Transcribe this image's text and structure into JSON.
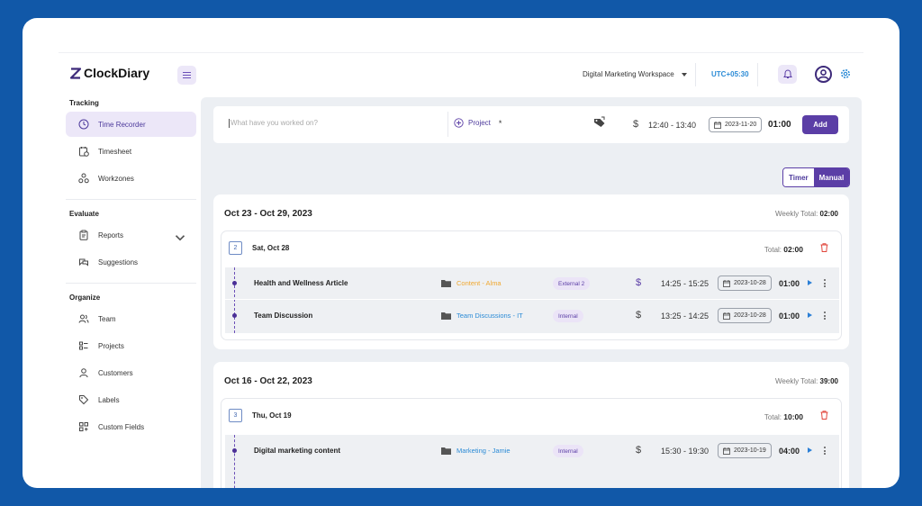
{
  "app": {
    "name": "ClockDiary"
  },
  "header": {
    "workspace": "Digital Marketing Workspace",
    "timezone": "UTC+05:30"
  },
  "sidebar": {
    "sections": [
      {
        "title": "Tracking",
        "items": [
          {
            "label": "Time Recorder",
            "icon": "clock-icon",
            "active": true
          },
          {
            "label": "Timesheet",
            "icon": "timesheet-icon"
          },
          {
            "label": "Workzones",
            "icon": "workzones-icon"
          }
        ]
      },
      {
        "title": "Evaluate",
        "items": [
          {
            "label": "Reports",
            "icon": "clipboard-icon",
            "has_chevron": true
          },
          {
            "label": "Suggestions",
            "icon": "suggestion-icon"
          }
        ]
      },
      {
        "title": "Organize",
        "items": [
          {
            "label": "Team",
            "icon": "team-icon"
          },
          {
            "label": "Projects",
            "icon": "projects-icon"
          },
          {
            "label": "Customers",
            "icon": "user-icon"
          },
          {
            "label": "Labels",
            "icon": "tag-icon"
          },
          {
            "label": "Custom Fields",
            "icon": "fields-icon"
          }
        ]
      }
    ]
  },
  "entry_bar": {
    "placeholder": "What have you worked on?",
    "project_label": "Project",
    "required_mark": "*",
    "billable_symbol": "$",
    "time_range": "12:40 - 13:40",
    "date": "2023-11-20",
    "duration": "01:00",
    "add_label": "Add"
  },
  "mode_toggle": {
    "timer": "Timer",
    "manual": "Manual",
    "selected": "Manual"
  },
  "weekly_total_label": "Weekly Total:",
  "day_total_label": "Total:",
  "weeks": [
    {
      "range": "Oct 23 - Oct 29, 2023",
      "total": "02:00",
      "day": {
        "count": "2",
        "title": "Sat, Oct 28",
        "total": "02:00",
        "entries": [
          {
            "description": "Health and Wellness Article",
            "project": "Content - Alma",
            "project_color": "#f0a830",
            "tag": "External 2",
            "billable": "$",
            "billable_color": "#5b3ea6",
            "time": "14:25 - 15:25",
            "date": "2023-10-28",
            "duration": "01:00"
          },
          {
            "description": "Team Discussion",
            "project": "Team Discussions - IT",
            "project_color": "#2b8bd6",
            "tag": "Internal",
            "billable": "$",
            "billable_color": "#555555",
            "time": "13:25 - 14:25",
            "date": "2023-10-28",
            "duration": "01:00"
          }
        ]
      }
    },
    {
      "range": "Oct 16 - Oct 22, 2023",
      "total": "39:00",
      "day": {
        "count": "3",
        "title": "Thu, Oct 19",
        "total": "10:00",
        "entries": [
          {
            "description": "Digital marketing content",
            "project": "Marketing - Jamie",
            "project_color": "#2b8bd6",
            "tag": "Internal",
            "billable": "$",
            "billable_color": "#555555",
            "time": "15:30 - 19:30",
            "date": "2023-10-19",
            "duration": "04:00"
          }
        ]
      }
    }
  ],
  "colors": {
    "accent": "#5b3ea6",
    "frame_bg": "#1158a8",
    "delete": "#e0443a",
    "play": "#2b7fd6"
  }
}
